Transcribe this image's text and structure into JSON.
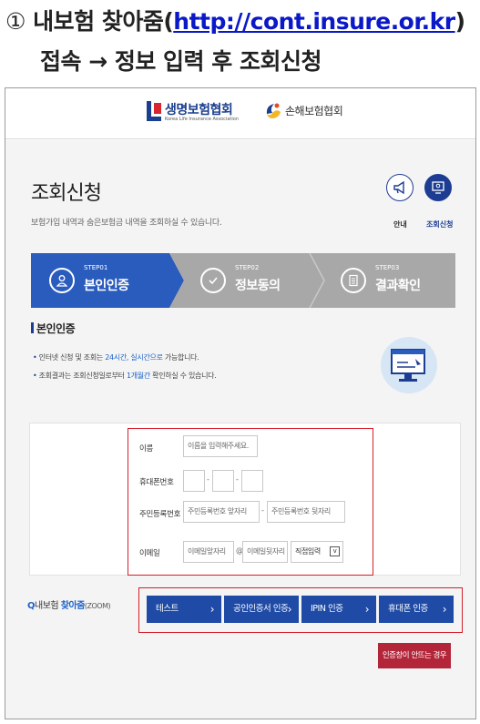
{
  "caption": {
    "number": "①",
    "line1_text": " 내보험 찾아줌(",
    "line1_url": "http://cont.insure.or.kr",
    "line1_close": ")",
    "line2": "접속 → 정보 입력 후 조회신청"
  },
  "logos": {
    "life": {
      "name": "생명보험협회",
      "sub": "Korea Life Insurance Association"
    },
    "nonlife": {
      "name": "손해보험협회"
    }
  },
  "page": {
    "title": "조회신청",
    "subtitle": "보험가입 내역과 숨은보험금 내역을 조회하실 수 있습니다.",
    "guide_label": "안내",
    "lookup_label": "조회신청"
  },
  "steps": [
    {
      "step": "STEP01",
      "name": "본인인증"
    },
    {
      "step": "STEP02",
      "name": "정보동의"
    },
    {
      "step": "STEP03",
      "name": "결과확인"
    }
  ],
  "section": {
    "title": "본인인증",
    "note1_pre": "인터넷 신청 및 조회는 ",
    "note1_hl": "24시간, 실시간으로",
    "note1_post": " 가능합니다.",
    "note2_pre": "조회결과는 조회신청일로부터 ",
    "note2_hl": "1개월간",
    "note2_post": " 확인하실 수 있습니다."
  },
  "form": {
    "name_label": "이름",
    "name_placeholder": "이름을 입력해주세요.",
    "phone_label": "휴대폰번호",
    "phone_sep": "-",
    "rrn_label": "주민등록번호",
    "rrn_front_placeholder": "주민등록번호 앞자리",
    "rrn_sep": "-",
    "rrn_back_placeholder": "주민등록번호 뒷자리",
    "email_label": "이메일",
    "email_front_placeholder": "이메일앞자리",
    "email_at": "@",
    "email_back_placeholder": "이메일뒷자리",
    "email_domain_selected": "직접입력"
  },
  "zoom": {
    "prefix": "내보험 ",
    "emph": "찾아줌",
    "suffix": "(ZOOM)"
  },
  "auth_buttons": [
    {
      "label": "테스트"
    },
    {
      "label": "공인인증서 인증"
    },
    {
      "label": "IPIN 인증"
    },
    {
      "label": "휴대폰 인증"
    }
  ],
  "cert_button": "인증창이 안뜨는 경우",
  "arrow": "›",
  "colors": {
    "primary": "#1d3d93",
    "step_active": "#2a5cbe",
    "step_inactive": "#a8a8a8",
    "button_blue": "#1f4ba6",
    "red_outline": "#d2202a",
    "cert_button": "#b3263a"
  }
}
